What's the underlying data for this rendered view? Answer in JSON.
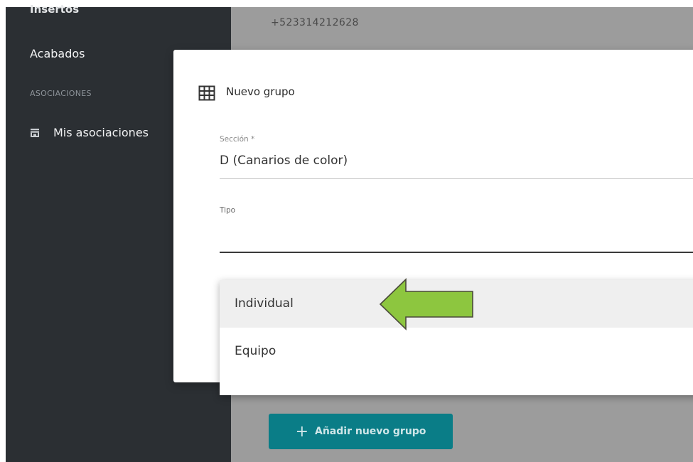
{
  "sidebar": {
    "cut_item": "Insertos",
    "item_acabados": "Acabados",
    "section_title": "ASOCIACIONES",
    "item_mis_asociaciones": "Mis asociaciones"
  },
  "background": {
    "phone": "+523314212628",
    "add_group_label": "Añadir nuevo grupo",
    "add_group_plus": "+"
  },
  "dialog": {
    "title": "Nuevo grupo",
    "seccion_label": "Sección *",
    "seccion_value": "D (Canarios de color)",
    "tipo_label": "Tipo",
    "options": [
      "Individual",
      "Equipo"
    ],
    "highlighted_option": "Individual"
  },
  "annotation": {
    "arrow_color": "#8dc63f"
  }
}
